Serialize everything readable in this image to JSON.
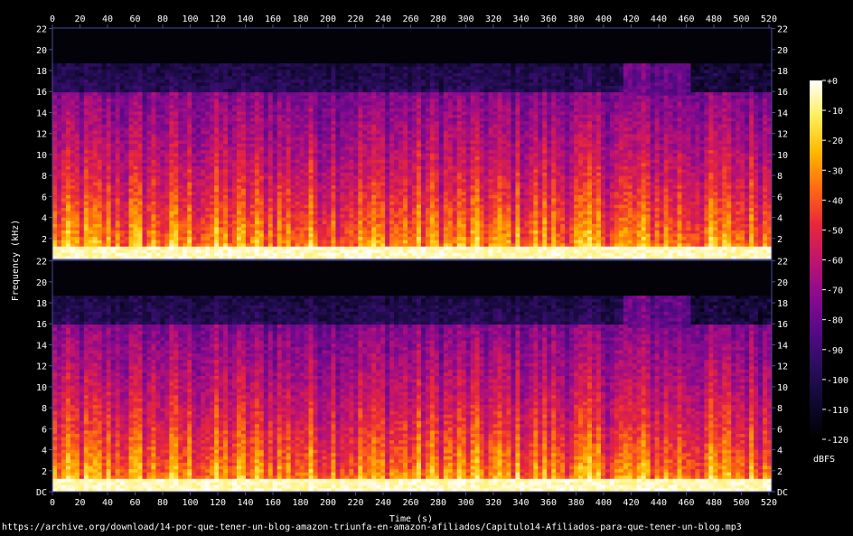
{
  "source_url": "https://archive.org/download/14-por-que-tener-un-blog-amazon-triunfa-en-amazon-afiliados/Capitulo14-Afiliados-para-que-tener-un-blog.mp3",
  "colors": {
    "background": "#000000",
    "axis": "#4a4a9a",
    "text": "#ffffff",
    "colormap": [
      "#000000",
      "#10082f",
      "#2a0e5e",
      "#550a86",
      "#8a0a8e",
      "#c0146e",
      "#e8283a",
      "#ff6a12",
      "#ffb800",
      "#ffee5a",
      "#ffffff"
    ]
  },
  "chart_data": {
    "type": "heatmap",
    "title": "",
    "xlabel": "Time (s)",
    "ylabel": "Frequency (kHz)",
    "xlim": [
      0,
      522
    ],
    "x_ticks": [
      0,
      20,
      40,
      60,
      80,
      100,
      120,
      140,
      160,
      180,
      200,
      220,
      240,
      260,
      280,
      300,
      320,
      340,
      360,
      380,
      400,
      420,
      440,
      460,
      480,
      500,
      520
    ],
    "channels": [
      {
        "name": "",
        "ylim": [
          0,
          22.05
        ],
        "y_ticks": [
          "22",
          "20",
          "18",
          "16",
          "14",
          "12",
          "10",
          "8",
          "6",
          "4",
          "2"
        ],
        "y_values": [
          22,
          20,
          18,
          16,
          14,
          12,
          10,
          8,
          6,
          4,
          2
        ]
      },
      {
        "name": "",
        "ylim": [
          0,
          22.05
        ],
        "y_ticks": [
          "22",
          "20",
          "18",
          "16",
          "14",
          "12",
          "10",
          "8",
          "6",
          "4",
          "2",
          "DC"
        ],
        "y_values": [
          22,
          20,
          18,
          16,
          14,
          12,
          10,
          8,
          6,
          4,
          2,
          0
        ]
      }
    ],
    "features": {
      "lowpass_cutoff_khz": 18.6,
      "shelf_khz": 16,
      "segment_change_s": 413,
      "segment2_change_s": 462
    },
    "colorbar": {
      "label": "dBFS",
      "range": [
        -120,
        0
      ],
      "ticks": [
        "+0",
        "-10",
        "-20",
        "-30",
        "-40",
        "-50",
        "-60",
        "-70",
        "-80",
        "-90",
        "-100",
        "-110",
        "-120"
      ],
      "tick_values": [
        0,
        -10,
        -20,
        -30,
        -40,
        -50,
        -60,
        -70,
        -80,
        -90,
        -100,
        -110,
        -120
      ]
    }
  }
}
